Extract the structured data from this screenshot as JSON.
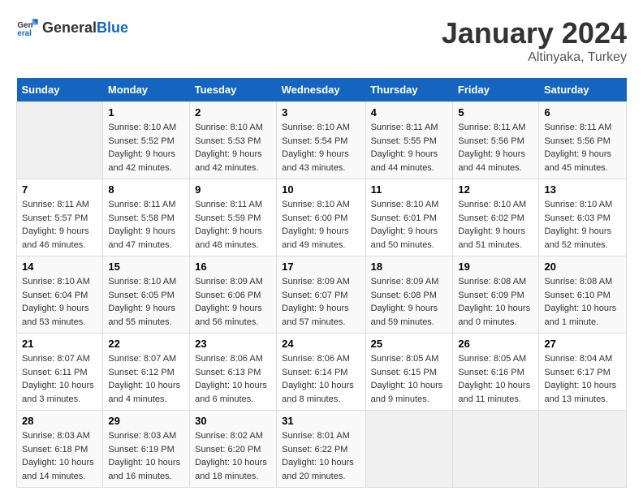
{
  "header": {
    "logo_general": "General",
    "logo_blue": "Blue",
    "month_year": "January 2024",
    "location": "Altinyaka, Turkey"
  },
  "calendar": {
    "days_of_week": [
      "Sunday",
      "Monday",
      "Tuesday",
      "Wednesday",
      "Thursday",
      "Friday",
      "Saturday"
    ],
    "weeks": [
      [
        {
          "day": "",
          "sunrise": "",
          "sunset": "",
          "daylight": ""
        },
        {
          "day": "1",
          "sunrise": "Sunrise: 8:10 AM",
          "sunset": "Sunset: 5:52 PM",
          "daylight": "Daylight: 9 hours and 42 minutes."
        },
        {
          "day": "2",
          "sunrise": "Sunrise: 8:10 AM",
          "sunset": "Sunset: 5:53 PM",
          "daylight": "Daylight: 9 hours and 42 minutes."
        },
        {
          "day": "3",
          "sunrise": "Sunrise: 8:10 AM",
          "sunset": "Sunset: 5:54 PM",
          "daylight": "Daylight: 9 hours and 43 minutes."
        },
        {
          "day": "4",
          "sunrise": "Sunrise: 8:11 AM",
          "sunset": "Sunset: 5:55 PM",
          "daylight": "Daylight: 9 hours and 44 minutes."
        },
        {
          "day": "5",
          "sunrise": "Sunrise: 8:11 AM",
          "sunset": "Sunset: 5:56 PM",
          "daylight": "Daylight: 9 hours and 44 minutes."
        },
        {
          "day": "6",
          "sunrise": "Sunrise: 8:11 AM",
          "sunset": "Sunset: 5:56 PM",
          "daylight": "Daylight: 9 hours and 45 minutes."
        }
      ],
      [
        {
          "day": "7",
          "sunrise": "Sunrise: 8:11 AM",
          "sunset": "Sunset: 5:57 PM",
          "daylight": "Daylight: 9 hours and 46 minutes."
        },
        {
          "day": "8",
          "sunrise": "Sunrise: 8:11 AM",
          "sunset": "Sunset: 5:58 PM",
          "daylight": "Daylight: 9 hours and 47 minutes."
        },
        {
          "day": "9",
          "sunrise": "Sunrise: 8:11 AM",
          "sunset": "Sunset: 5:59 PM",
          "daylight": "Daylight: 9 hours and 48 minutes."
        },
        {
          "day": "10",
          "sunrise": "Sunrise: 8:10 AM",
          "sunset": "Sunset: 6:00 PM",
          "daylight": "Daylight: 9 hours and 49 minutes."
        },
        {
          "day": "11",
          "sunrise": "Sunrise: 8:10 AM",
          "sunset": "Sunset: 6:01 PM",
          "daylight": "Daylight: 9 hours and 50 minutes."
        },
        {
          "day": "12",
          "sunrise": "Sunrise: 8:10 AM",
          "sunset": "Sunset: 6:02 PM",
          "daylight": "Daylight: 9 hours and 51 minutes."
        },
        {
          "day": "13",
          "sunrise": "Sunrise: 8:10 AM",
          "sunset": "Sunset: 6:03 PM",
          "daylight": "Daylight: 9 hours and 52 minutes."
        }
      ],
      [
        {
          "day": "14",
          "sunrise": "Sunrise: 8:10 AM",
          "sunset": "Sunset: 6:04 PM",
          "daylight": "Daylight: 9 hours and 53 minutes."
        },
        {
          "day": "15",
          "sunrise": "Sunrise: 8:10 AM",
          "sunset": "Sunset: 6:05 PM",
          "daylight": "Daylight: 9 hours and 55 minutes."
        },
        {
          "day": "16",
          "sunrise": "Sunrise: 8:09 AM",
          "sunset": "Sunset: 6:06 PM",
          "daylight": "Daylight: 9 hours and 56 minutes."
        },
        {
          "day": "17",
          "sunrise": "Sunrise: 8:09 AM",
          "sunset": "Sunset: 6:07 PM",
          "daylight": "Daylight: 9 hours and 57 minutes."
        },
        {
          "day": "18",
          "sunrise": "Sunrise: 8:09 AM",
          "sunset": "Sunset: 6:08 PM",
          "daylight": "Daylight: 9 hours and 59 minutes."
        },
        {
          "day": "19",
          "sunrise": "Sunrise: 8:08 AM",
          "sunset": "Sunset: 6:09 PM",
          "daylight": "Daylight: 10 hours and 0 minutes."
        },
        {
          "day": "20",
          "sunrise": "Sunrise: 8:08 AM",
          "sunset": "Sunset: 6:10 PM",
          "daylight": "Daylight: 10 hours and 1 minute."
        }
      ],
      [
        {
          "day": "21",
          "sunrise": "Sunrise: 8:07 AM",
          "sunset": "Sunset: 6:11 PM",
          "daylight": "Daylight: 10 hours and 3 minutes."
        },
        {
          "day": "22",
          "sunrise": "Sunrise: 8:07 AM",
          "sunset": "Sunset: 6:12 PM",
          "daylight": "Daylight: 10 hours and 4 minutes."
        },
        {
          "day": "23",
          "sunrise": "Sunrise: 8:06 AM",
          "sunset": "Sunset: 6:13 PM",
          "daylight": "Daylight: 10 hours and 6 minutes."
        },
        {
          "day": "24",
          "sunrise": "Sunrise: 8:06 AM",
          "sunset": "Sunset: 6:14 PM",
          "daylight": "Daylight: 10 hours and 8 minutes."
        },
        {
          "day": "25",
          "sunrise": "Sunrise: 8:05 AM",
          "sunset": "Sunset: 6:15 PM",
          "daylight": "Daylight: 10 hours and 9 minutes."
        },
        {
          "day": "26",
          "sunrise": "Sunrise: 8:05 AM",
          "sunset": "Sunset: 6:16 PM",
          "daylight": "Daylight: 10 hours and 11 minutes."
        },
        {
          "day": "27",
          "sunrise": "Sunrise: 8:04 AM",
          "sunset": "Sunset: 6:17 PM",
          "daylight": "Daylight: 10 hours and 13 minutes."
        }
      ],
      [
        {
          "day": "28",
          "sunrise": "Sunrise: 8:03 AM",
          "sunset": "Sunset: 6:18 PM",
          "daylight": "Daylight: 10 hours and 14 minutes."
        },
        {
          "day": "29",
          "sunrise": "Sunrise: 8:03 AM",
          "sunset": "Sunset: 6:19 PM",
          "daylight": "Daylight: 10 hours and 16 minutes."
        },
        {
          "day": "30",
          "sunrise": "Sunrise: 8:02 AM",
          "sunset": "Sunset: 6:20 PM",
          "daylight": "Daylight: 10 hours and 18 minutes."
        },
        {
          "day": "31",
          "sunrise": "Sunrise: 8:01 AM",
          "sunset": "Sunset: 6:22 PM",
          "daylight": "Daylight: 10 hours and 20 minutes."
        },
        {
          "day": "",
          "sunrise": "",
          "sunset": "",
          "daylight": ""
        },
        {
          "day": "",
          "sunrise": "",
          "sunset": "",
          "daylight": ""
        },
        {
          "day": "",
          "sunrise": "",
          "sunset": "",
          "daylight": ""
        }
      ]
    ]
  }
}
